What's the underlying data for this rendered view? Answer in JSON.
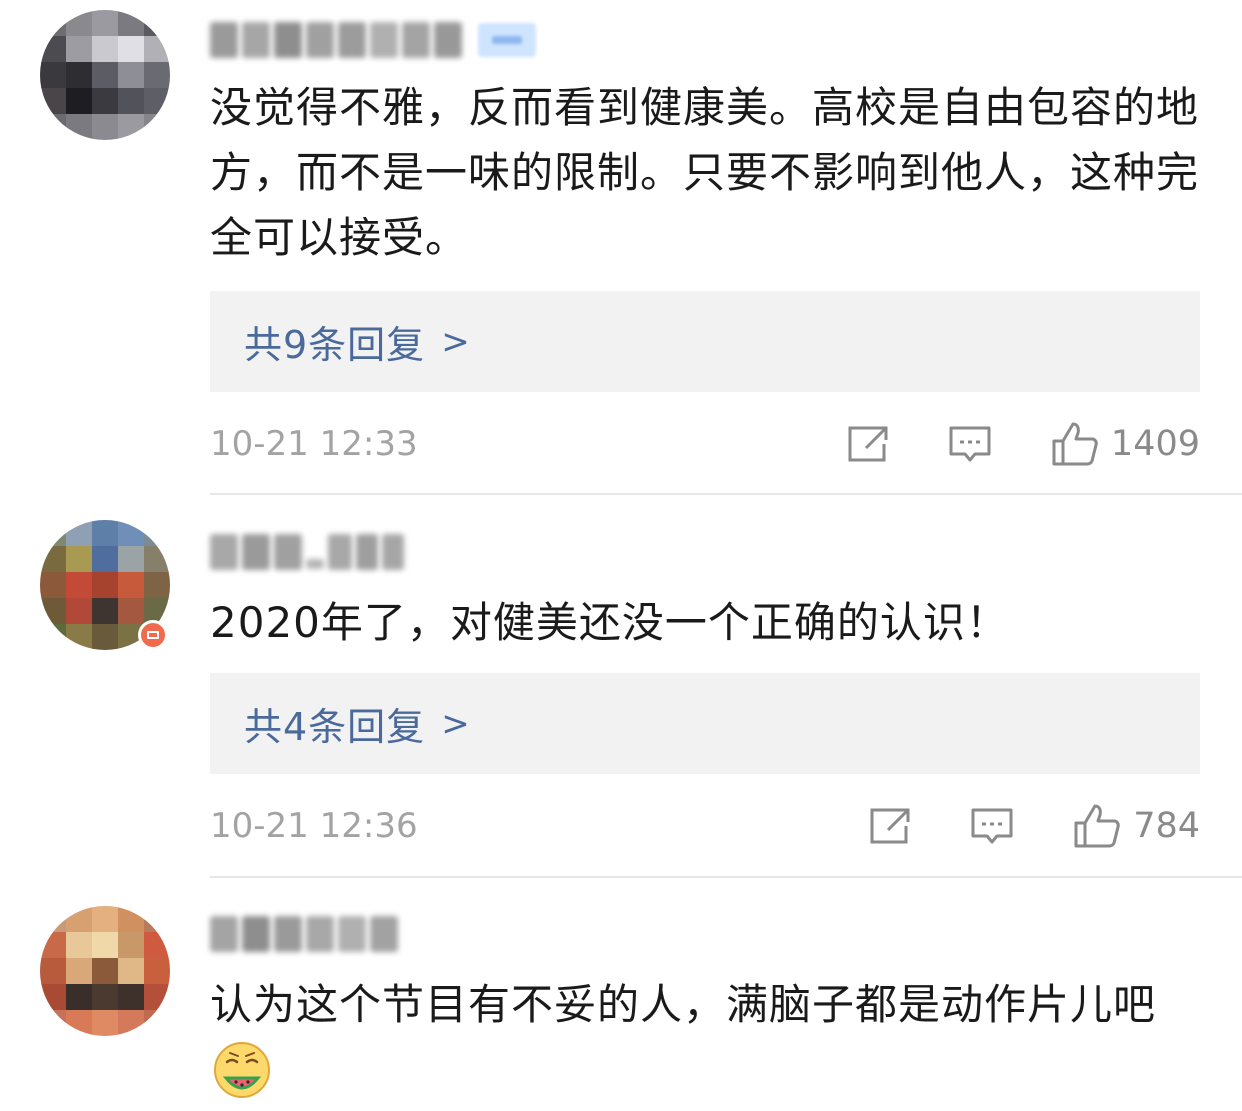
{
  "comments": [
    {
      "text": "没觉得不雅，反而看到健康美。高校是自由包容的地方，而不是一味的限制。只要不影响到他人，这种完全可以接受。",
      "reply_label": "共9条回复",
      "reply_chevron": ">",
      "timestamp": "10-21 12:33",
      "likes": "1409"
    },
    {
      "text": "2020年了，对健美还没一个正确的认识！",
      "reply_label": "共4条回复",
      "reply_chevron": ">",
      "timestamp": "10-21 12:36",
      "likes": "784"
    },
    {
      "text": "认为这个节目有不妥的人，满脑子都是动作片儿吧"
    }
  ],
  "colors": {
    "link": "#4a6a9c",
    "meta_text": "#a3a3a3",
    "reply_bg": "#f2f2f2"
  },
  "icons": {
    "share": "share-icon",
    "comment": "comment-icon",
    "like": "thumbs-up-icon",
    "emoji": "eating-watermelon-emoji-icon"
  }
}
